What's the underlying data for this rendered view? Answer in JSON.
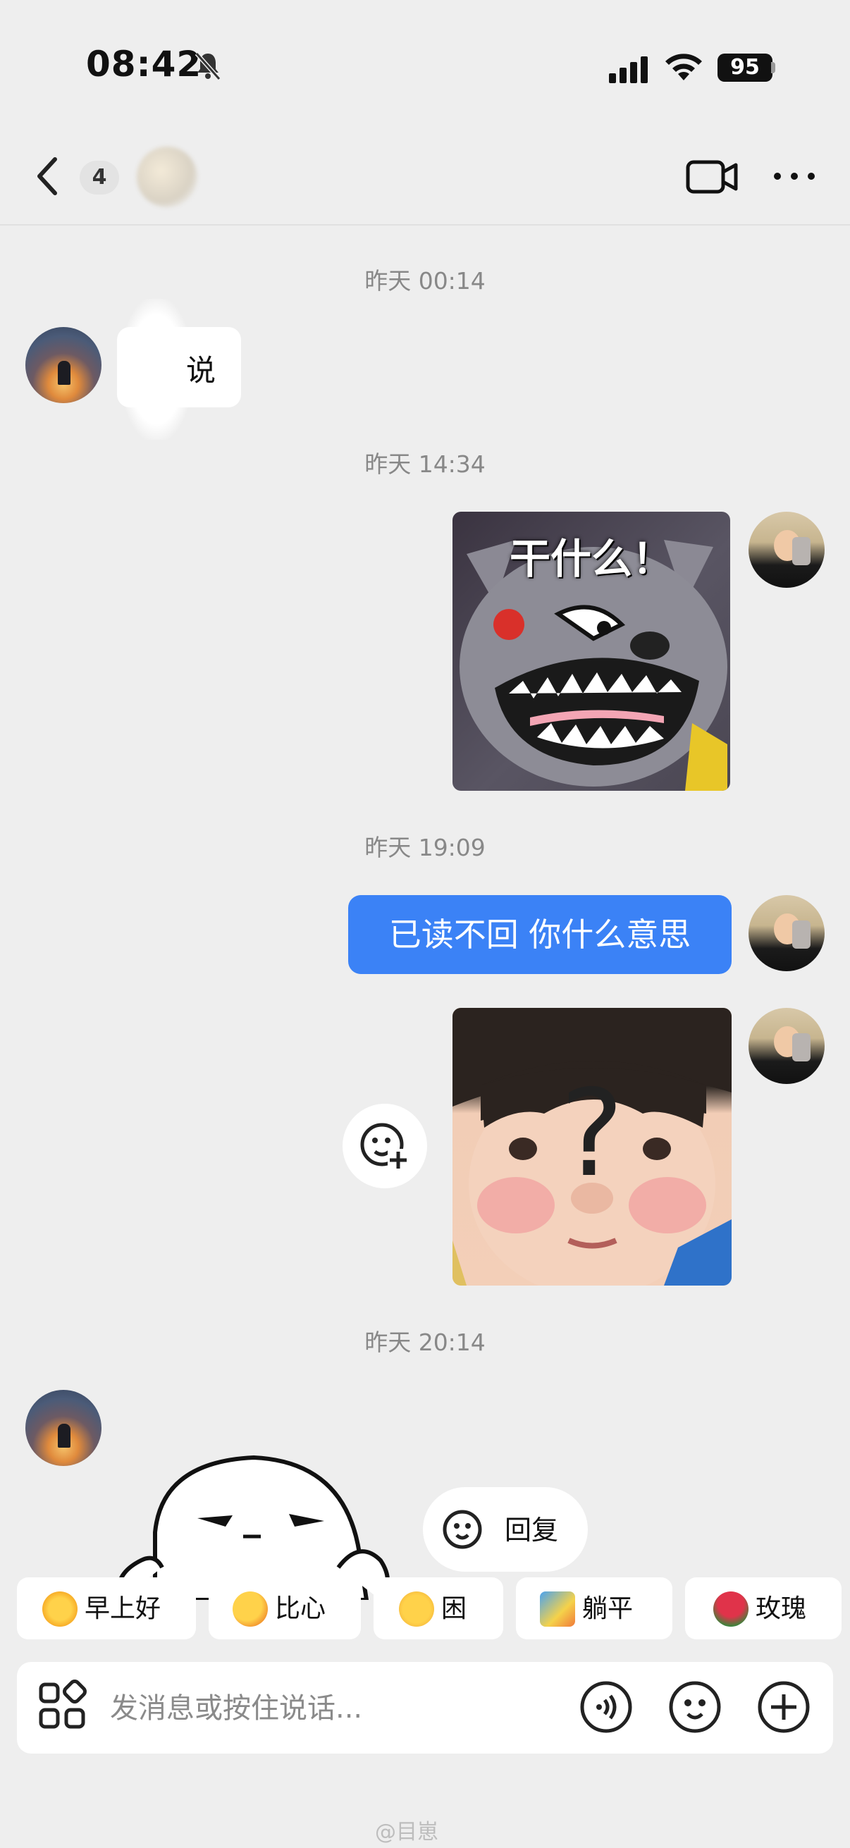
{
  "status_bar": {
    "time": "08:42",
    "battery": "95"
  },
  "nav": {
    "unread_count": "4"
  },
  "timestamps": [
    "昨天 00:14",
    "昨天 14:34",
    "昨天 19:09",
    "昨天 20:14"
  ],
  "messages": {
    "left_text": "说",
    "sticker1_caption": "干什么！",
    "blue_text": "已读不回 你什么意思",
    "sticker2_caption": "?"
  },
  "reply_pill": {
    "label": "回复"
  },
  "quick_replies": [
    {
      "label": "早上好",
      "icon": "sun-sunglasses-emoji"
    },
    {
      "label": "比心",
      "icon": "heart-hand-emoji"
    },
    {
      "label": "困",
      "icon": "sleepy-face-emoji"
    },
    {
      "label": "躺平",
      "icon": "lying-flat-emoji"
    },
    {
      "label": "玫瑰",
      "icon": "rose-emoji"
    }
  ],
  "input": {
    "placeholder": "发消息或按住说话..."
  },
  "watermark": "@目崽",
  "colors": {
    "accent": "#3b82f6",
    "background": "#eeeeee"
  }
}
